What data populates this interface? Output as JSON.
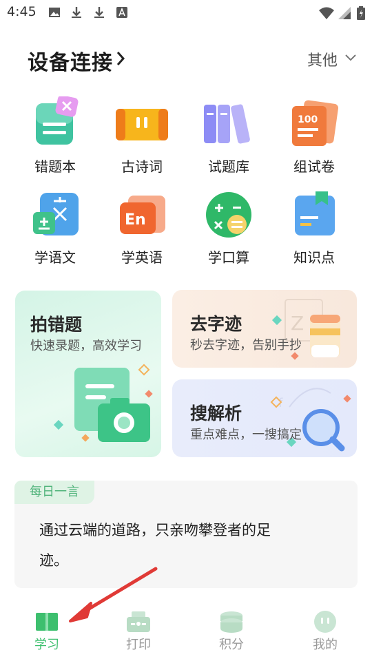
{
  "status_bar": {
    "time": "4:45"
  },
  "header": {
    "title": "设备连接",
    "other_label": "其他"
  },
  "tools": [
    {
      "label": "错题本"
    },
    {
      "label": "古诗词"
    },
    {
      "label": "试题库"
    },
    {
      "label": "组试卷"
    },
    {
      "label": "学语文"
    },
    {
      "label": "学英语"
    },
    {
      "label": "学口算"
    },
    {
      "label": "知识点"
    }
  ],
  "cards": {
    "photo_wrong": {
      "title": "拍错题",
      "subtitle": "快速录题，高效学习"
    },
    "remove_handwriting": {
      "title": "去字迹",
      "subtitle": "秒去字迹，告别手抄"
    },
    "search_analysis": {
      "title": "搜解析",
      "subtitle": "重点难点，一搜搞定"
    }
  },
  "quote": {
    "tag": "每日一言",
    "line1": "通过云端的道路，只亲吻攀登者的足",
    "line2": "迹。"
  },
  "tabs": [
    {
      "label": "学习",
      "active": true
    },
    {
      "label": "打印",
      "active": false
    },
    {
      "label": "积分",
      "active": false
    },
    {
      "label": "我的",
      "active": false
    }
  ],
  "colors": {
    "accent": "#3dbf6e",
    "tab_inactive": "#9a9a9a",
    "arrow": "#e03a36"
  }
}
